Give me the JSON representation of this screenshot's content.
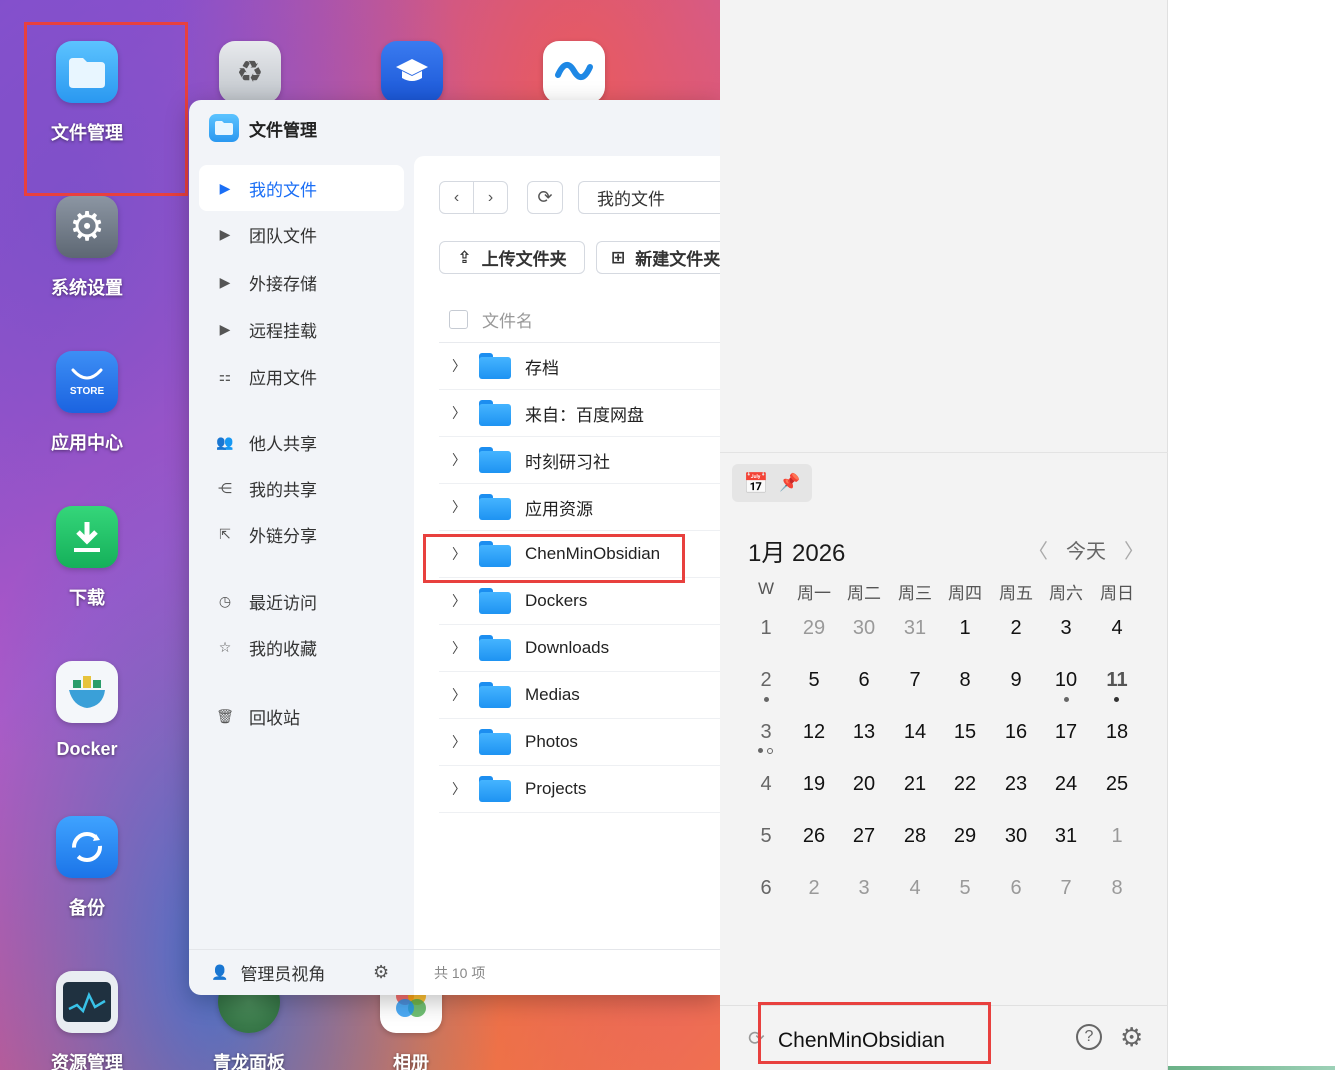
{
  "desktop": {
    "apps": [
      {
        "label": "文件管理",
        "icon": "folder-icon"
      },
      {
        "label": "系统设置",
        "icon": "gear-icon"
      },
      {
        "label": "应用中心",
        "icon": "store-icon",
        "badge": "STORE"
      },
      {
        "label": "下载",
        "icon": "download-icon"
      },
      {
        "label": "Docker",
        "icon": "docker-icon"
      },
      {
        "label": "备份",
        "icon": "backup-icon"
      },
      {
        "label": "资源管理",
        "icon": "monitor-icon"
      },
      {
        "label": "青龙面板",
        "icon": "qinglong-icon"
      },
      {
        "label": "相册",
        "icon": "photos-icon"
      }
    ],
    "top_apps": [
      "recycle-icon",
      "graduation-cap-icon",
      "sync-icon"
    ]
  },
  "file_manager": {
    "title": "文件管理",
    "sidebar": {
      "items": [
        {
          "label": "我的文件",
          "icon": "caret-right-icon"
        },
        {
          "label": "团队文件",
          "icon": "caret-right-icon"
        },
        {
          "label": "外接存储",
          "icon": "caret-right-icon"
        },
        {
          "label": "远程挂载",
          "icon": "caret-right-icon"
        },
        {
          "label": "应用文件",
          "icon": "apps-icon"
        },
        {
          "label": "他人共享",
          "icon": "users-icon"
        },
        {
          "label": "我的共享",
          "icon": "share-icon"
        },
        {
          "label": "外链分享",
          "icon": "external-link-icon"
        },
        {
          "label": "最近访问",
          "icon": "clock-icon"
        },
        {
          "label": "我的收藏",
          "icon": "star-icon"
        },
        {
          "label": "回收站",
          "icon": "trash-icon"
        }
      ],
      "footer": "管理员视角"
    },
    "path": "我的文件",
    "upload_label": "上传文件夹",
    "new_folder_label": "新建文件夹",
    "column_name": "文件名",
    "rows": [
      "存档",
      "来自：百度网盘",
      "时刻研习社",
      "应用资源",
      "ChenMinObsidian",
      "Dockers",
      "Downloads",
      "Medias",
      "Photos",
      "Projects"
    ],
    "footer": "共 10 项"
  },
  "calendar": {
    "month_title": "1月 2026",
    "today_label": "今天",
    "week_header": "W",
    "day_headers": [
      "周一",
      "周二",
      "周三",
      "周四",
      "周五",
      "周六",
      "周日"
    ],
    "weeks": [
      {
        "w": "1",
        "days": [
          "29",
          "30",
          "31",
          "1",
          "2",
          "3",
          "4"
        ]
      },
      {
        "w": "2",
        "days": [
          "5",
          "6",
          "7",
          "8",
          "9",
          "10",
          "11"
        ]
      },
      {
        "w": "3",
        "days": [
          "12",
          "13",
          "14",
          "15",
          "16",
          "17",
          "18"
        ]
      },
      {
        "w": "4",
        "days": [
          "19",
          "20",
          "21",
          "22",
          "23",
          "24",
          "25"
        ]
      },
      {
        "w": "5",
        "days": [
          "26",
          "27",
          "28",
          "29",
          "30",
          "31",
          "1"
        ]
      },
      {
        "w": "6",
        "days": [
          "2",
          "3",
          "4",
          "5",
          "6",
          "7",
          "8"
        ]
      }
    ]
  },
  "status_bar": {
    "text": "ChenMinObsidian"
  },
  "colors": {
    "accent": "#1a6ef5",
    "highlight": "#e8403e"
  }
}
